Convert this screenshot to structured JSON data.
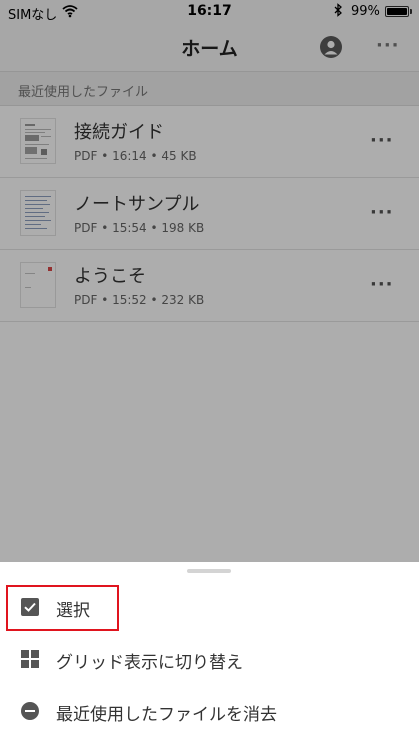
{
  "status_bar": {
    "carrier": "SIMなし",
    "time": "16:17",
    "battery": "99%",
    "battery_level": 0.99,
    "icons": [
      "wifi-icon",
      "bluetooth-icon",
      "battery-icon"
    ]
  },
  "nav": {
    "title": "ホーム",
    "more": "···",
    "icons": [
      "profile-icon",
      "more-icon"
    ]
  },
  "recent": {
    "header": "最近使用したファイル",
    "files": [
      {
        "name": "接続ガイド",
        "meta": "PDF • 16:14 • 45 KB",
        "more": "···"
      },
      {
        "name": "ノートサンプル",
        "meta": "PDF • 15:54 • 198 KB",
        "more": "···"
      },
      {
        "name": "ようこそ",
        "meta": "PDF • 15:52 • 232 KB",
        "more": "···"
      }
    ]
  },
  "sheet": {
    "items": [
      {
        "label": "選択",
        "icon": "checkbox-icon"
      },
      {
        "label": "グリッド表示に切り替え",
        "icon": "grid-icon"
      },
      {
        "label": "最近使用したファイルを消去",
        "icon": "minus-circle-icon"
      }
    ],
    "highlight_color": "#e0141e"
  }
}
